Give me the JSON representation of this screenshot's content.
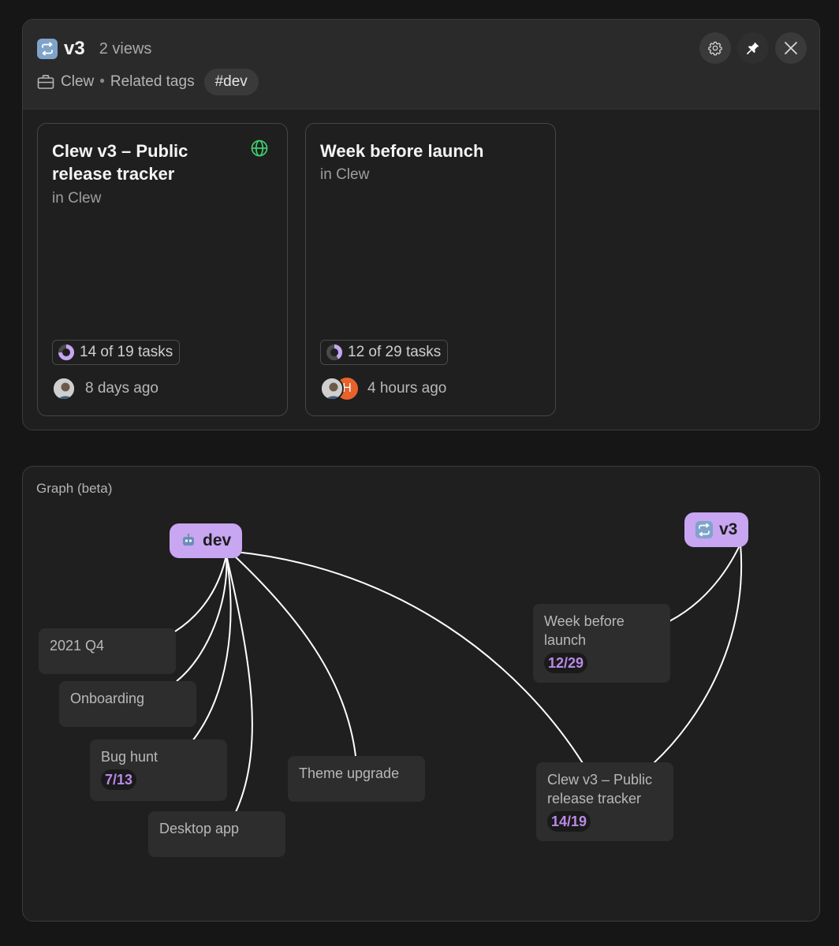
{
  "header": {
    "title": "v3",
    "views": "2 views",
    "workspace": "Clew",
    "separator": "•",
    "related_label": "Related tags",
    "tag": "#dev"
  },
  "header_buttons": {
    "settings_icon": "gear-icon",
    "pin_icon": "pin-icon",
    "close_icon": "close-icon"
  },
  "cards": [
    {
      "title": "Clew v3 – Public release tracker",
      "location": "in Clew",
      "public_icon": "globe-icon",
      "tasks": "14 of 19 tasks",
      "progress": 0.74,
      "updated": "8 days ago"
    },
    {
      "title": "Week before launch",
      "location": "in Clew",
      "tasks": "12 of 29 tasks",
      "progress": 0.41,
      "avatar_letter": "H",
      "updated": "4 hours ago"
    }
  ],
  "graph": {
    "label": "Graph (beta)",
    "tags": {
      "dev": "dev",
      "v3": "v3"
    },
    "nodes": {
      "q4": {
        "title": "2021 Q4"
      },
      "onboarding": {
        "title": "Onboarding"
      },
      "bughunt": {
        "title": "Bug hunt",
        "count": "7/13"
      },
      "desktop": {
        "title": "Desktop app"
      },
      "theme": {
        "title": "Theme upgrade"
      },
      "week": {
        "title": "Week before launch",
        "count": "12/29"
      },
      "clew": {
        "title": "Clew v3 – Public release tracker",
        "count": "14/19"
      }
    }
  },
  "colors": {
    "accent_tag": "#c8a6f2",
    "count_text": "#b98ae6",
    "globe": "#3ecf6e",
    "avatar_h": "#e8622c"
  }
}
